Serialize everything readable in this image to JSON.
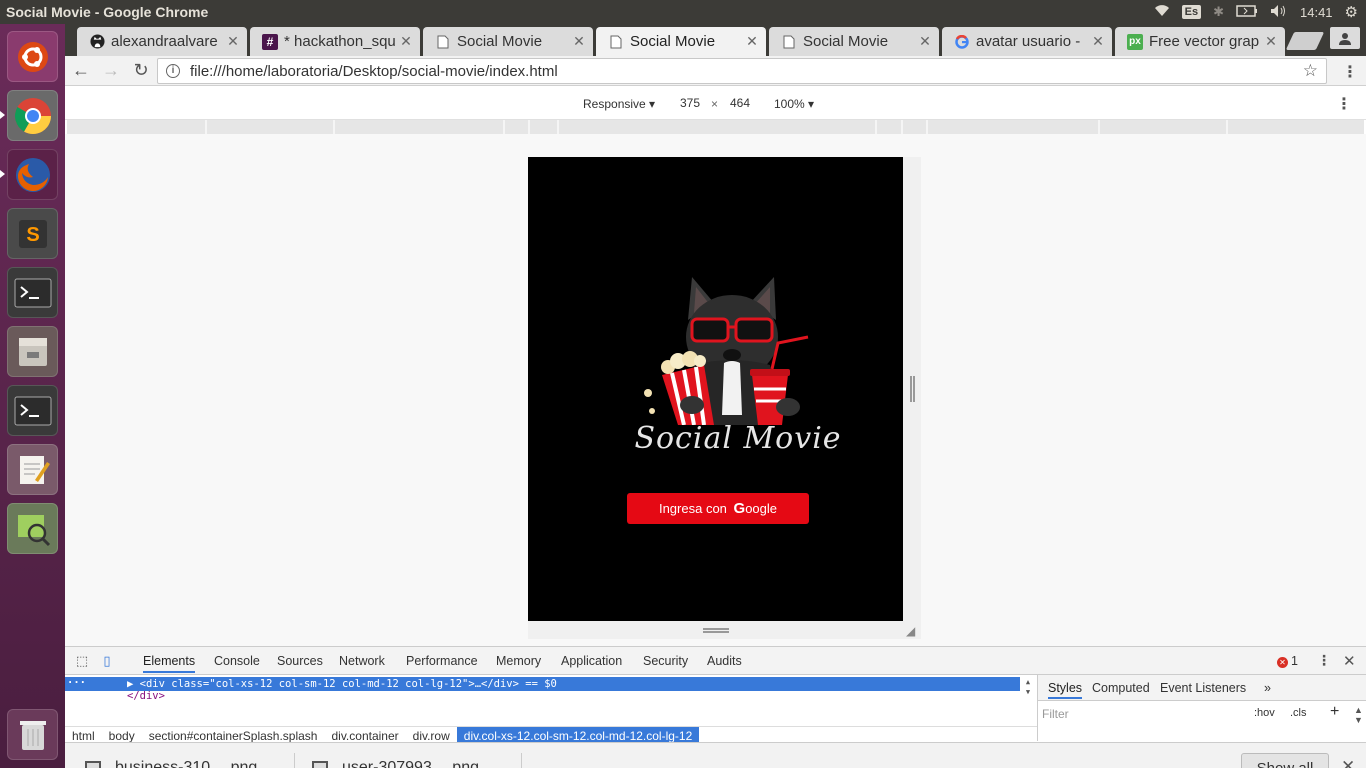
{
  "system": {
    "window_title": "Social Movie - Google Chrome",
    "keyboard_layout": "Es",
    "clock": "14:41"
  },
  "launcher": {
    "items": [
      "ubuntu-dash",
      "chromium",
      "firefox",
      "sublime-text",
      "terminal",
      "files",
      "terminal",
      "text-editor",
      "image-viewer",
      "trash"
    ]
  },
  "browser": {
    "tabs": [
      {
        "label": "alexandraalvare",
        "icon": "github-icon"
      },
      {
        "label": "* hackathon_squ",
        "icon": "slack-icon"
      },
      {
        "label": "Social Movie",
        "icon": "page-icon"
      },
      {
        "label": "Social Movie",
        "icon": "page-icon",
        "active": true
      },
      {
        "label": "Social Movie",
        "icon": "page-icon"
      },
      {
        "label": "avatar usuario -",
        "icon": "google-icon"
      },
      {
        "label": "Free vector grap",
        "icon": "px-icon"
      }
    ],
    "url": "file:///home/laboratoria/Desktop/social-movie/index.html"
  },
  "device_toolbar": {
    "mode": "Responsive",
    "width": "375",
    "separator": "×",
    "height": "464",
    "zoom": "100%"
  },
  "page": {
    "brand": "Social Movie",
    "login_button_prefix": "Ingresa con",
    "login_button_g": "G",
    "login_button_suffix": "oogle",
    "colors": {
      "background": "#000000",
      "button": "#e50914",
      "brand_text": "#e6e6e6"
    }
  },
  "devtools": {
    "tabs": [
      "Elements",
      "Console",
      "Sources",
      "Network",
      "Performance",
      "Memory",
      "Application",
      "Security",
      "Audits"
    ],
    "error_count": "1",
    "selected_node": "<div class=\"col-xs-12 col-sm-12 col-md-12 col-lg-12\">…</div> == $0",
    "closing_tag": "</div>",
    "breadcrumbs": [
      "html",
      "body",
      "section#containerSplash.splash",
      "div.container",
      "div.row",
      "div.col-xs-12.col-sm-12.col-md-12.col-lg-12"
    ],
    "side_tabs": [
      "Styles",
      "Computed",
      "Event Listeners"
    ],
    "filter_placeholder": "Filter",
    "hov_label": ":hov",
    "cls_label": ".cls"
  },
  "downloads": {
    "items": [
      "business-310….png",
      "user-307993….png"
    ],
    "show_all": "Show all"
  }
}
